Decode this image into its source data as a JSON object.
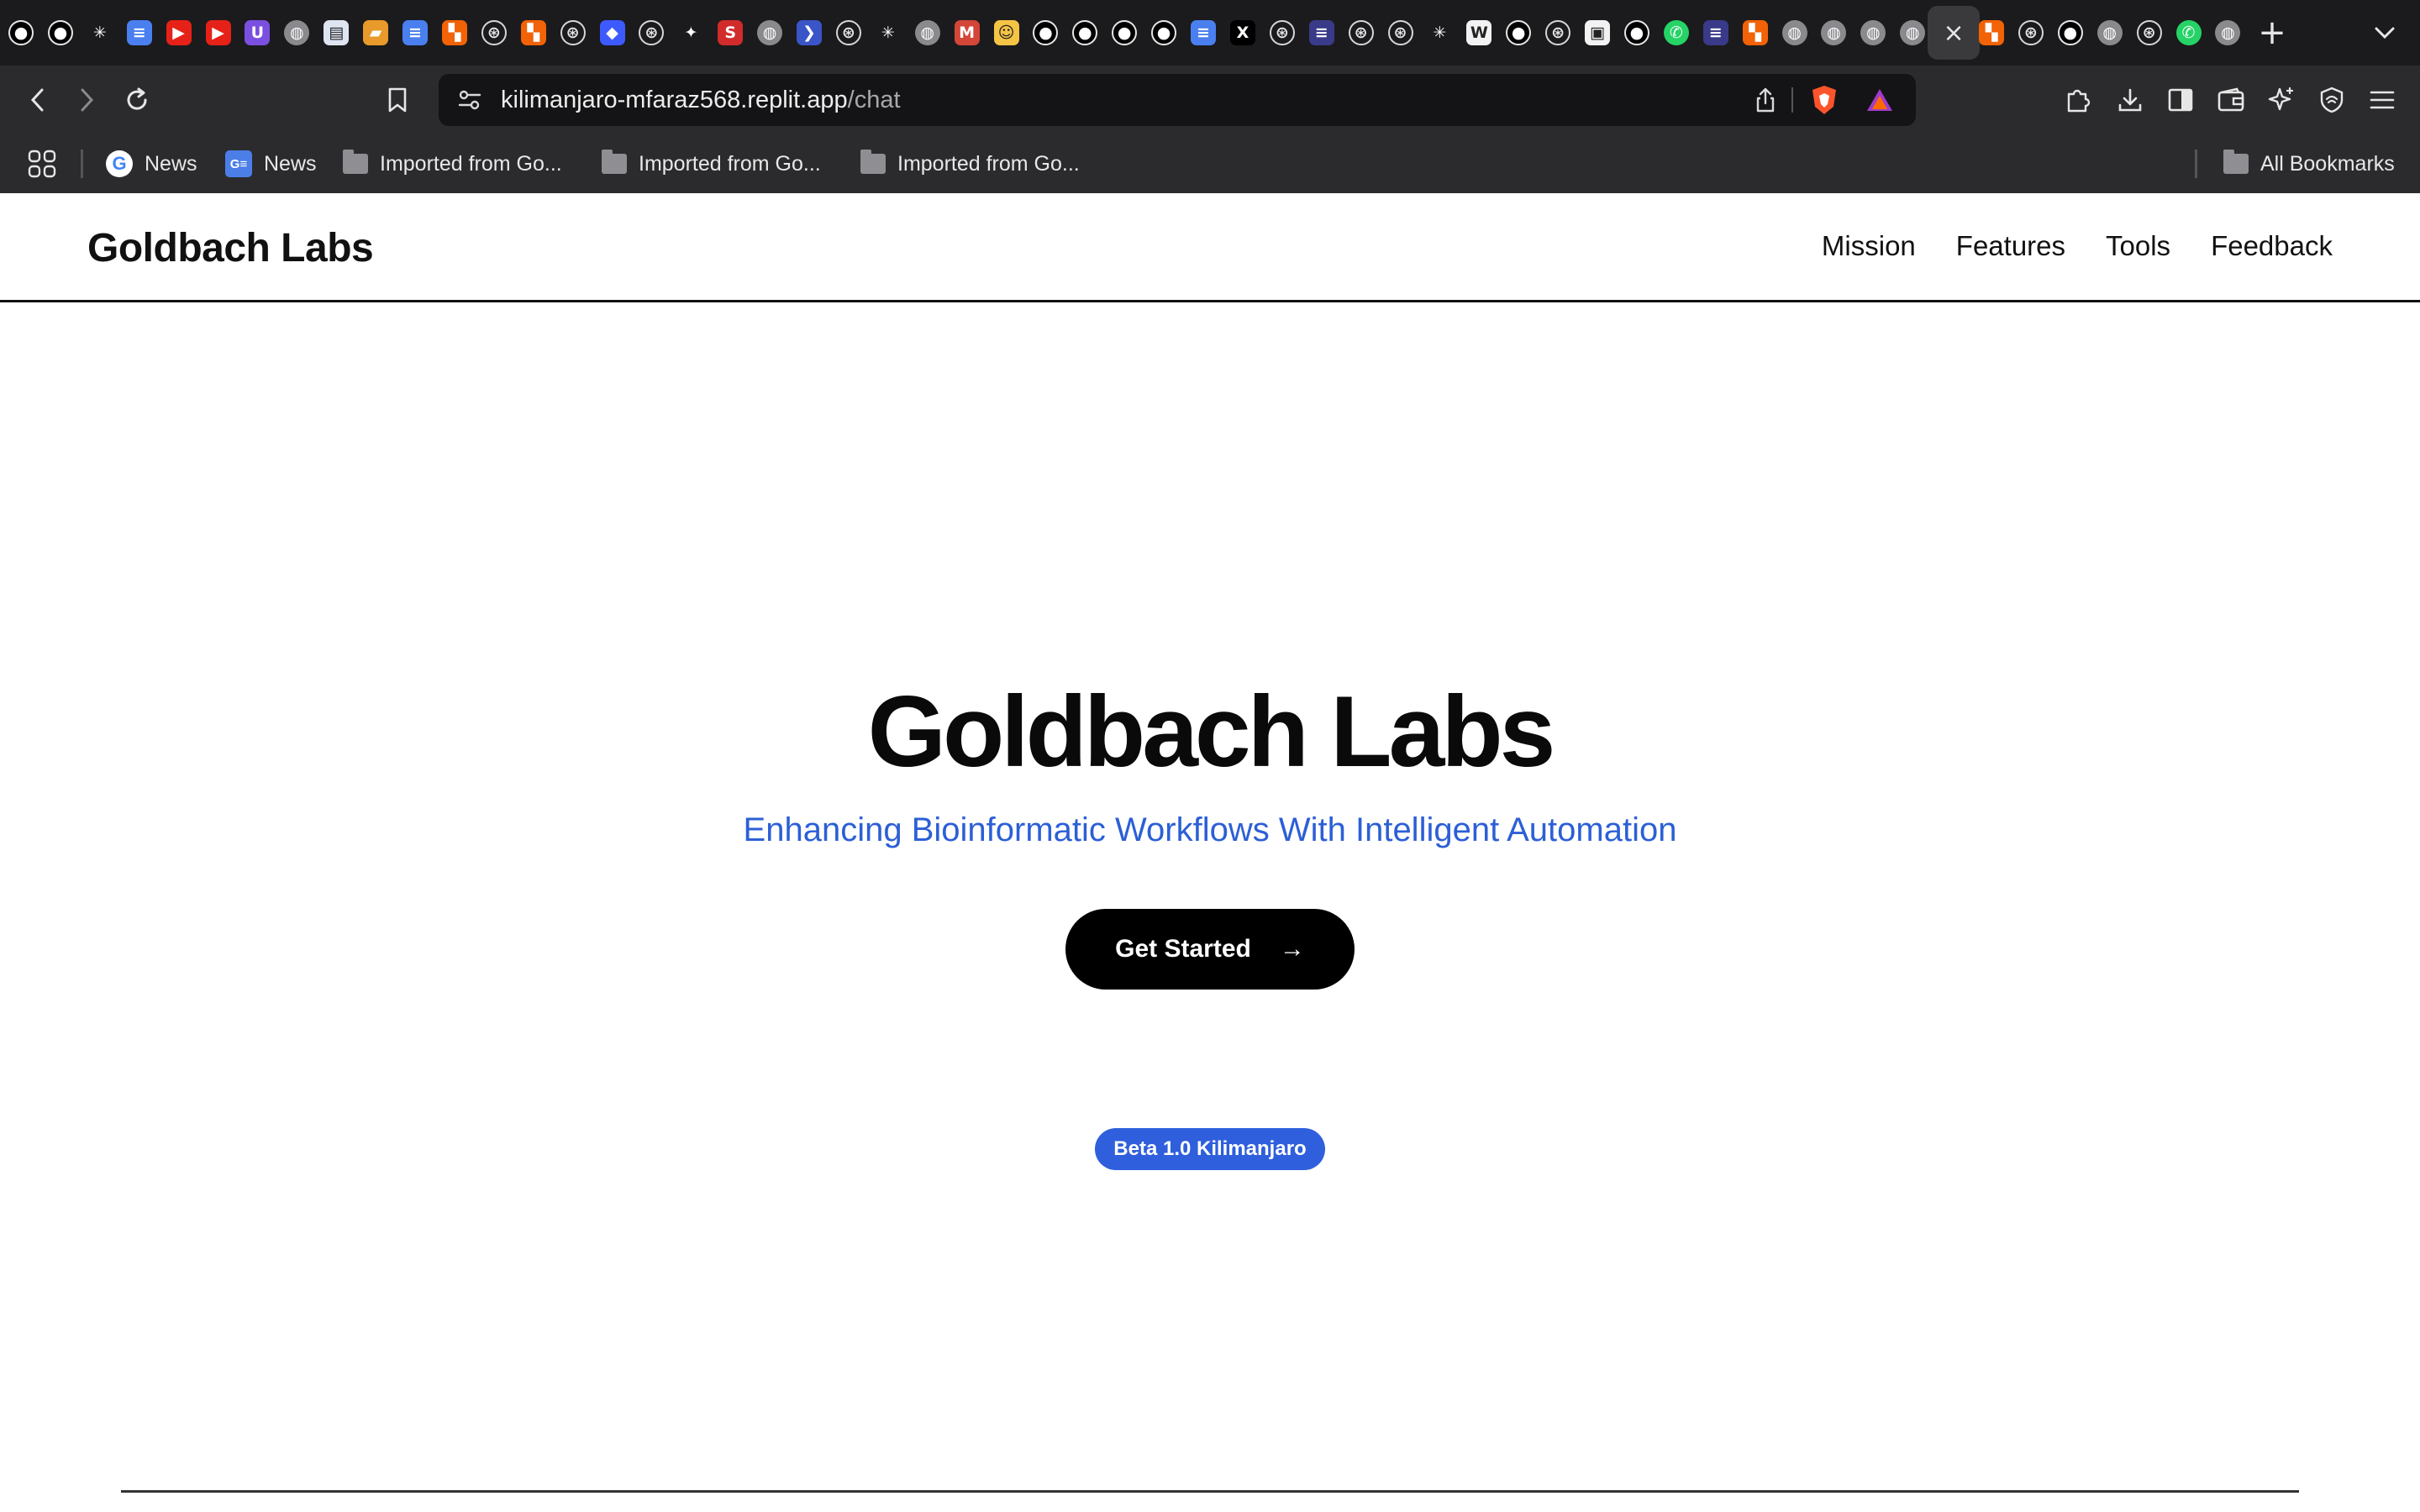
{
  "browser": {
    "tabs": [
      {
        "icon": "github-icon",
        "glyph": "●",
        "bg": "#000000"
      },
      {
        "icon": "github-icon",
        "glyph": "●",
        "bg": "#000000"
      },
      {
        "icon": "perplexity-icon",
        "glyph": "✳",
        "bg": "#1b1b1d"
      },
      {
        "icon": "google-docs-icon",
        "glyph": "≡",
        "bg": "#4a7ff0"
      },
      {
        "icon": "youtube-icon",
        "glyph": "▶",
        "bg": "#e62117"
      },
      {
        "icon": "youtube-icon",
        "glyph": "▶",
        "bg": "#e62117"
      },
      {
        "icon": "proton-icon",
        "glyph": "U",
        "bg": "#7b4fe0"
      },
      {
        "icon": "globe-icon",
        "glyph": "◍",
        "bg": "#8a8a8e"
      },
      {
        "icon": "pdf-icon",
        "glyph": "▤",
        "bg": "#dfe6f2"
      },
      {
        "icon": "inbox-icon",
        "glyph": "▰",
        "bg": "#e89a2a"
      },
      {
        "icon": "google-docs-icon",
        "glyph": "≡",
        "bg": "#4a7ff0"
      },
      {
        "icon": "replit-icon",
        "glyph": "▚",
        "bg": "#f26207"
      },
      {
        "icon": "chatgpt-icon",
        "glyph": "⊛",
        "bg": "#1b1b1d"
      },
      {
        "icon": "replit-icon",
        "glyph": "▚",
        "bg": "#f26207"
      },
      {
        "icon": "chatgpt-icon",
        "glyph": "⊛",
        "bg": "#1b1b1d"
      },
      {
        "icon": "bird-icon",
        "glyph": "◆",
        "bg": "#3d5afe"
      },
      {
        "icon": "chatgpt-icon",
        "glyph": "⊛",
        "bg": "#1b1b1d"
      },
      {
        "icon": "gemini-icon",
        "glyph": "✦",
        "bg": "#1b1b1d"
      },
      {
        "icon": "scribd-icon",
        "glyph": "S",
        "bg": "#d22b2b"
      },
      {
        "icon": "globe-icon",
        "glyph": "◍",
        "bg": "#8a8a8e"
      },
      {
        "icon": "arrow-app-icon",
        "glyph": "❯",
        "bg": "#3a55c7"
      },
      {
        "icon": "chatgpt-icon",
        "glyph": "⊛",
        "bg": "#1b1b1d"
      },
      {
        "icon": "perplexity-icon",
        "glyph": "✳",
        "bg": "#1b1b1d"
      },
      {
        "icon": "globe-icon",
        "glyph": "◍",
        "bg": "#8a8a8e"
      },
      {
        "icon": "gmail-icon",
        "glyph": "M",
        "bg": "#d44638"
      },
      {
        "icon": "huggingface-icon",
        "glyph": "☺",
        "bg": "#f6c445"
      },
      {
        "icon": "github-icon",
        "glyph": "●",
        "bg": "#000000"
      },
      {
        "icon": "github-icon",
        "glyph": "●",
        "bg": "#000000"
      },
      {
        "icon": "github-icon",
        "glyph": "●",
        "bg": "#000000"
      },
      {
        "icon": "github-icon",
        "glyph": "●",
        "bg": "#000000"
      },
      {
        "icon": "google-docs-icon",
        "glyph": "≡",
        "bg": "#4a7ff0"
      },
      {
        "icon": "x-icon",
        "glyph": "X",
        "bg": "#000000"
      },
      {
        "icon": "chatgpt-icon",
        "glyph": "⊛",
        "bg": "#1b1b1d"
      },
      {
        "icon": "notion-icon",
        "glyph": "≡",
        "bg": "#3a3a8a"
      },
      {
        "icon": "chatgpt-icon",
        "glyph": "⊛",
        "bg": "#1b1b1d"
      },
      {
        "icon": "chatgpt-icon",
        "glyph": "⊛",
        "bg": "#1b1b1d"
      },
      {
        "icon": "perplexity-icon",
        "glyph": "✳",
        "bg": "#1b1b1d"
      },
      {
        "icon": "wikipedia-icon",
        "glyph": "W",
        "bg": "#f2f2f2"
      },
      {
        "icon": "github-icon",
        "glyph": "●",
        "bg": "#000000"
      },
      {
        "icon": "chatgpt-icon",
        "glyph": "⊛",
        "bg": "#1b1b1d"
      },
      {
        "icon": "app-icon",
        "glyph": "▣",
        "bg": "#f2f2f2"
      },
      {
        "icon": "github-icon",
        "glyph": "●",
        "bg": "#000000"
      },
      {
        "icon": "whatsapp-icon",
        "glyph": "✆",
        "bg": "#25d366"
      },
      {
        "icon": "notion-icon",
        "glyph": "≡",
        "bg": "#3a3a8a"
      },
      {
        "icon": "replit-icon",
        "glyph": "▚",
        "bg": "#f26207"
      },
      {
        "icon": "globe-icon",
        "glyph": "◍",
        "bg": "#8a8a8e"
      },
      {
        "icon": "globe-icon",
        "glyph": "◍",
        "bg": "#8a8a8e"
      },
      {
        "icon": "globe-icon",
        "glyph": "◍",
        "bg": "#8a8a8e"
      },
      {
        "icon": "globe-icon",
        "glyph": "◍",
        "bg": "#8a8a8e"
      },
      {
        "icon": "close-icon",
        "glyph": "×",
        "bg": "",
        "active": true
      },
      {
        "icon": "replit-icon",
        "glyph": "▚",
        "bg": "#f26207"
      },
      {
        "icon": "chatgpt-icon",
        "glyph": "⊛",
        "bg": "#1b1b1d"
      },
      {
        "icon": "github-icon",
        "glyph": "●",
        "bg": "#000000"
      },
      {
        "icon": "globe-icon",
        "glyph": "◍",
        "bg": "#8a8a8e"
      },
      {
        "icon": "chatgpt-icon",
        "glyph": "⊛",
        "bg": "#1b1b1d"
      },
      {
        "icon": "whatsapp-icon",
        "glyph": "✆",
        "bg": "#25d366"
      },
      {
        "icon": "globe-icon",
        "glyph": "◍",
        "bg": "#8a8a8e"
      }
    ],
    "new_tab_glyph": "+",
    "url_host": "kilimanjaro-mfaraz568.replit.app",
    "url_path": "/chat",
    "bookmarks": [
      {
        "label": "News",
        "icon": "google-icon",
        "glyph": "G"
      },
      {
        "label": "News",
        "icon": "google-news-icon",
        "glyph": "G≡"
      },
      {
        "label": "Imported from Go...",
        "icon": "folder-icon"
      },
      {
        "label": "Imported from Go...",
        "icon": "folder-icon"
      },
      {
        "label": "Imported from Go...",
        "icon": "folder-icon"
      }
    ],
    "all_bookmarks": "All Bookmarks"
  },
  "site": {
    "brand": "Goldbach Labs",
    "nav": [
      "Mission",
      "Features",
      "Tools",
      "Feedback"
    ],
    "hero_title": "Goldbach Labs",
    "hero_subtitle": "Enhancing Bioinformatic Workflows With Intelligent Automation",
    "cta_label": "Get Started",
    "cta_arrow": "→",
    "badge": "Beta 1.0 Kilimanjaro"
  },
  "colors": {
    "accent_blue": "#2c5fd6",
    "badge_blue": "#2f5fdc",
    "browser_dark": "#2b2b2e"
  }
}
